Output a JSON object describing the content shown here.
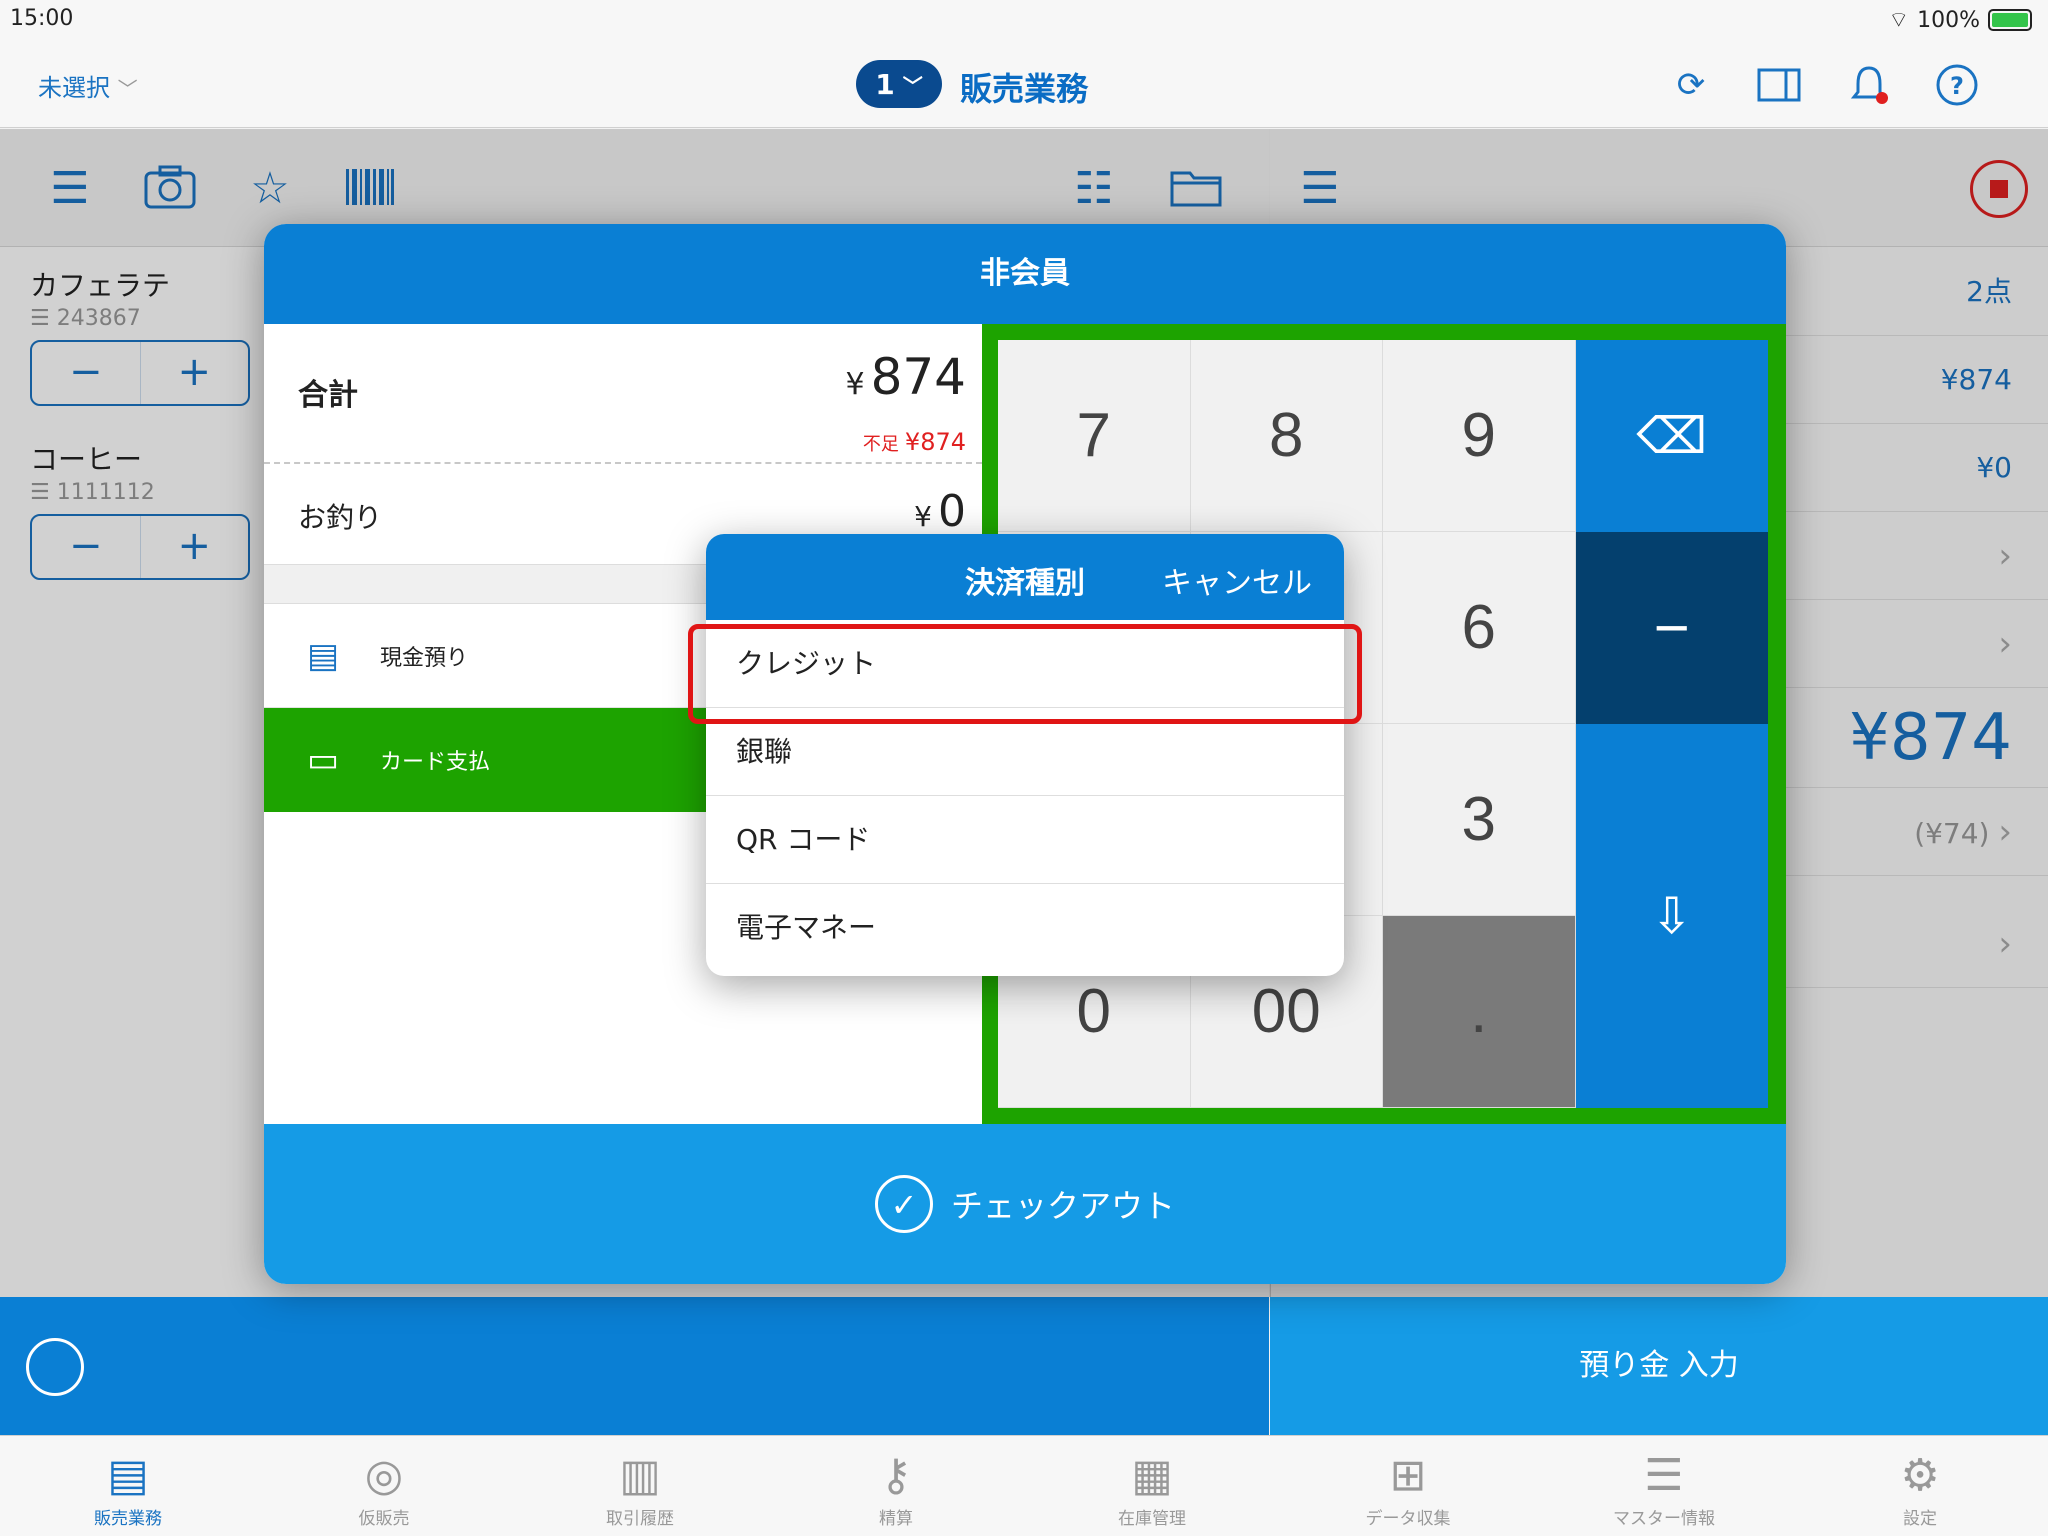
{
  "status": {
    "time": "15:00",
    "battery": "100%"
  },
  "nav": {
    "unselected": "未選択",
    "register_no": "1",
    "title": "販売業務"
  },
  "cart": {
    "items": [
      {
        "name": "カフェラテ",
        "code": "243867"
      },
      {
        "name": "コーヒー",
        "code": "1111112"
      }
    ]
  },
  "right_panel": {
    "count": "2点",
    "subtotal": "¥874",
    "discount": "¥0",
    "total": "¥874",
    "tax": "(¥74)",
    "deposit_button": "預り金 入力"
  },
  "modal": {
    "title": "非会員",
    "total_label": "合計",
    "total_value": "874",
    "short_label": "不足",
    "short_value": "¥874",
    "change_label": "お釣り",
    "change_value": "0",
    "currency": "¥",
    "pay_cash": "現金預り",
    "pay_card": "カード支払",
    "checkout": "チェックアウト",
    "keys": [
      "7",
      "8",
      "9",
      "⌫",
      "",
      "",
      "6",
      "−",
      "",
      "",
      "3",
      "⇩",
      "0",
      "00",
      "."
    ]
  },
  "popover": {
    "title": "決済種別",
    "cancel": "キャンセル",
    "options": [
      "クレジット",
      "銀聯",
      "QR コード",
      "電子マネー"
    ]
  },
  "tabs": [
    {
      "label": "販売業務",
      "icon": "register-icon",
      "active": true
    },
    {
      "label": "仮販売",
      "icon": "temp-sale-icon",
      "active": false
    },
    {
      "label": "取引履歴",
      "icon": "history-icon",
      "active": false
    },
    {
      "label": "精算",
      "icon": "key-icon",
      "active": false
    },
    {
      "label": "在庫管理",
      "icon": "inventory-icon",
      "active": false
    },
    {
      "label": "データ収集",
      "icon": "data-icon",
      "active": false
    },
    {
      "label": "マスター情報",
      "icon": "database-icon",
      "active": false
    },
    {
      "label": "設定",
      "icon": "gear-icon",
      "active": false
    }
  ]
}
